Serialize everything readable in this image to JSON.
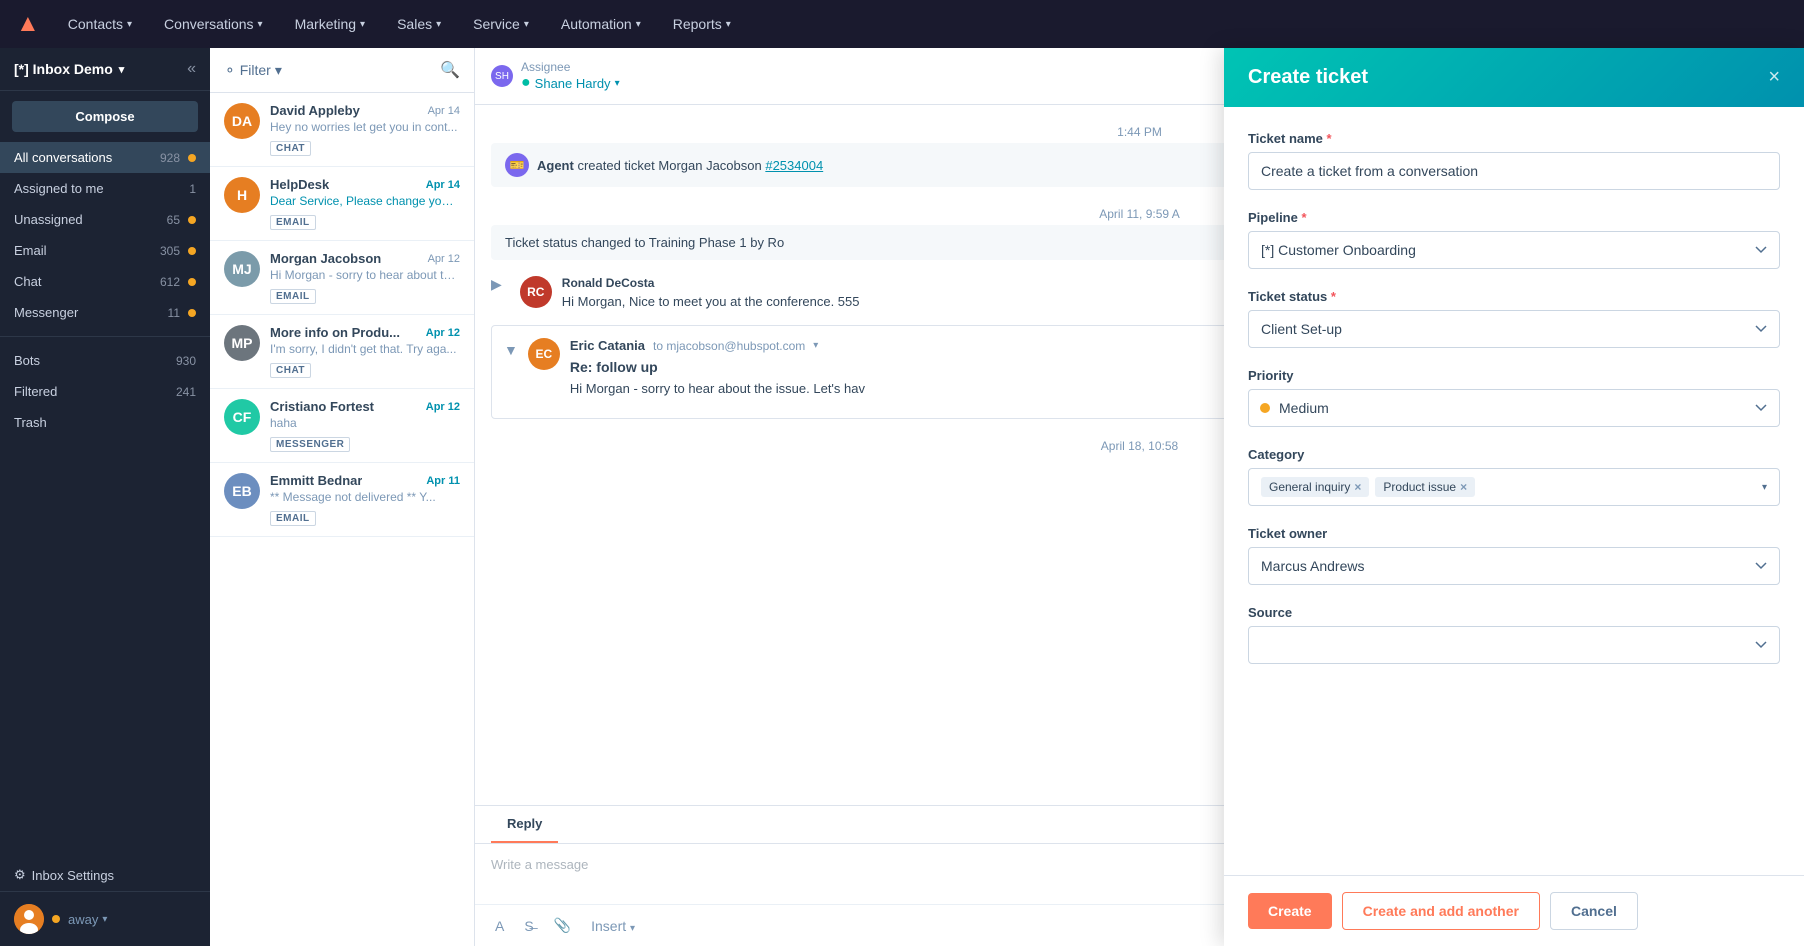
{
  "topNav": {
    "logo": "HubSpot",
    "items": [
      {
        "label": "Contacts",
        "hasDropdown": true
      },
      {
        "label": "Conversations",
        "hasDropdown": true
      },
      {
        "label": "Marketing",
        "hasDropdown": true
      },
      {
        "label": "Sales",
        "hasDropdown": true
      },
      {
        "label": "Service",
        "hasDropdown": true
      },
      {
        "label": "Automation",
        "hasDropdown": true
      },
      {
        "label": "Reports",
        "hasDropdown": true
      }
    ],
    "createTicketLabel": "Create ticket"
  },
  "sidebar": {
    "title": "[*] Inbox Demo",
    "composeLabel": "Compose",
    "navItems": [
      {
        "label": "All conversations",
        "count": "928",
        "hasDot": true,
        "active": true
      },
      {
        "label": "Assigned to me",
        "count": "1",
        "hasDot": false
      },
      {
        "label": "Unassigned",
        "count": "65",
        "hasDot": true
      },
      {
        "label": "Email",
        "count": "305",
        "hasDot": true
      },
      {
        "label": "Chat",
        "count": "612",
        "hasDot": true
      },
      {
        "label": "Messenger",
        "count": "11",
        "hasDot": true
      }
    ],
    "secondaryItems": [
      {
        "label": "Bots",
        "count": "930"
      },
      {
        "label": "Filtered",
        "count": "241"
      },
      {
        "label": "Trash",
        "count": ""
      }
    ],
    "user": {
      "name": "Away",
      "status": "away"
    },
    "settingsLabel": "Inbox Settings"
  },
  "convList": {
    "filterLabel": "Filter",
    "conversations": [
      {
        "name": "David Appleby",
        "date": "Apr 14",
        "preview": "Hey no worries let get you in cont...",
        "tag": "CHAT",
        "avatarColor": "#e67e22",
        "initials": "DA",
        "unread": false
      },
      {
        "name": "HelpDesk",
        "date": "Apr 14",
        "preview": "Dear Service, Please change your...",
        "tag": "EMAIL",
        "avatarColor": "#e67e22",
        "initials": "H",
        "unread": true
      },
      {
        "name": "Morgan Jacobson",
        "date": "Apr 12",
        "preview": "Hi Morgan - sorry to hear about th...",
        "tag": "EMAIL",
        "avatarColor": "#7b9baa",
        "initials": "MJ",
        "unread": false
      },
      {
        "name": "More info on Produ...",
        "date": "Apr 12",
        "preview": "I'm sorry, I didn't get that. Try aga...",
        "tag": "CHAT",
        "avatarColor": "#6c757d",
        "initials": "MP",
        "unread": true
      },
      {
        "name": "Cristiano Fortest",
        "date": "Apr 12",
        "preview": "haha",
        "tag": "MESSENGER",
        "avatarColor": "#20c9a5",
        "initials": "CF",
        "unread": true
      },
      {
        "name": "Emmitt Bednar",
        "date": "Apr 11",
        "preview": "** Message not delivered ** Y...",
        "tag": "EMAIL",
        "avatarColor": "#6c8ebf",
        "initials": "EB",
        "unread": true
      }
    ]
  },
  "chat": {
    "assignee": {
      "label": "Assignee",
      "value": "Shane Hardy"
    },
    "messages": [
      {
        "type": "system",
        "text": "Agent created ticket Morgan Jacobson",
        "link": "#2534004",
        "time": "1:44 PM"
      },
      {
        "type": "system-status",
        "text": "Ticket status changed to Training Phase 1 by Ro",
        "time": "April 11, 9:59 A"
      },
      {
        "type": "email-collapsed",
        "sender": "Ronald DeCosta",
        "preview": "Hi Morgan, Nice to meet you at the conference. 555",
        "avatarColor": "#c0392b",
        "initials": "RC"
      },
      {
        "type": "email-expanded",
        "sender": "Eric Catania",
        "to": "to mjacobson@hubspot.com",
        "subject": "Re: follow up",
        "body": "Hi Morgan - sorry to hear about the issue. Let's hav",
        "avatarColor": "#e67e22",
        "initials": "EC"
      }
    ],
    "replyTabLabel": "Reply",
    "inputPlaceholder": "Write a message",
    "insertLabel": "Insert",
    "footerDate": "April 18, 10:58"
  },
  "panel": {
    "title": "Create ticket",
    "closeIcon": "×",
    "fields": {
      "ticketName": {
        "label": "Ticket name",
        "required": true,
        "value": "Create a ticket from a conversation"
      },
      "pipeline": {
        "label": "Pipeline",
        "required": true,
        "value": "[*] Customer Onboarding"
      },
      "ticketStatus": {
        "label": "Ticket status",
        "required": true,
        "value": "Client Set-up"
      },
      "priority": {
        "label": "Priority",
        "value": "Medium",
        "dotColor": "#f5a623"
      },
      "category": {
        "label": "Category",
        "tags": [
          {
            "label": "General inquiry"
          },
          {
            "label": "Product issue"
          }
        ]
      },
      "ticketOwner": {
        "label": "Ticket owner",
        "value": "Marcus Andrews"
      },
      "source": {
        "label": "Source",
        "value": ""
      }
    },
    "buttons": {
      "create": "Create",
      "createAndAddAnother": "Create and add another",
      "cancel": "Cancel"
    }
  }
}
